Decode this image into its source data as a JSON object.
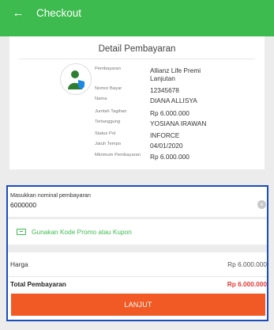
{
  "appbar": {
    "back_icon": "arrow-left-icon",
    "title": "Checkout",
    "color": "#3dbb4f"
  },
  "detail": {
    "title": "Detail Pembayaran",
    "rows": [
      {
        "label": "Pembayaran",
        "value": "Allianz Life Premi Lanjutan"
      },
      {
        "label": "Nomor Bayar",
        "value": "12345678"
      },
      {
        "label": "Nama",
        "value": "DIANA ALLISYA"
      },
      {
        "label": "Jumlah Tagihan",
        "value": "Rp 6.000.000"
      },
      {
        "label": "Tertanggung",
        "value": "YOSIANA IRAWAN"
      },
      {
        "label": "Status Pol",
        "value": "INFORCE"
      },
      {
        "label": "Jatuh Tempo",
        "value": "04/01/2020"
      },
      {
        "label": "Minimum Pembayaran",
        "value": "Rp 6.000.000"
      }
    ]
  },
  "payment": {
    "label": "Masukkan nominal pembayaran",
    "value": "6000000",
    "clear_icon": "close-circle-icon"
  },
  "promo": {
    "icon": "ticket-icon",
    "text": "Gunakan Kode Promo atau Kupon"
  },
  "summary": {
    "price_label": "Harga",
    "price_value": "Rp 6.000.000",
    "total_label": "Total Pembayaran",
    "total_value": "Rp 6.000.000",
    "total_color": "#e53935"
  },
  "cta": {
    "label": "LANJUT",
    "color": "#f15a24"
  }
}
